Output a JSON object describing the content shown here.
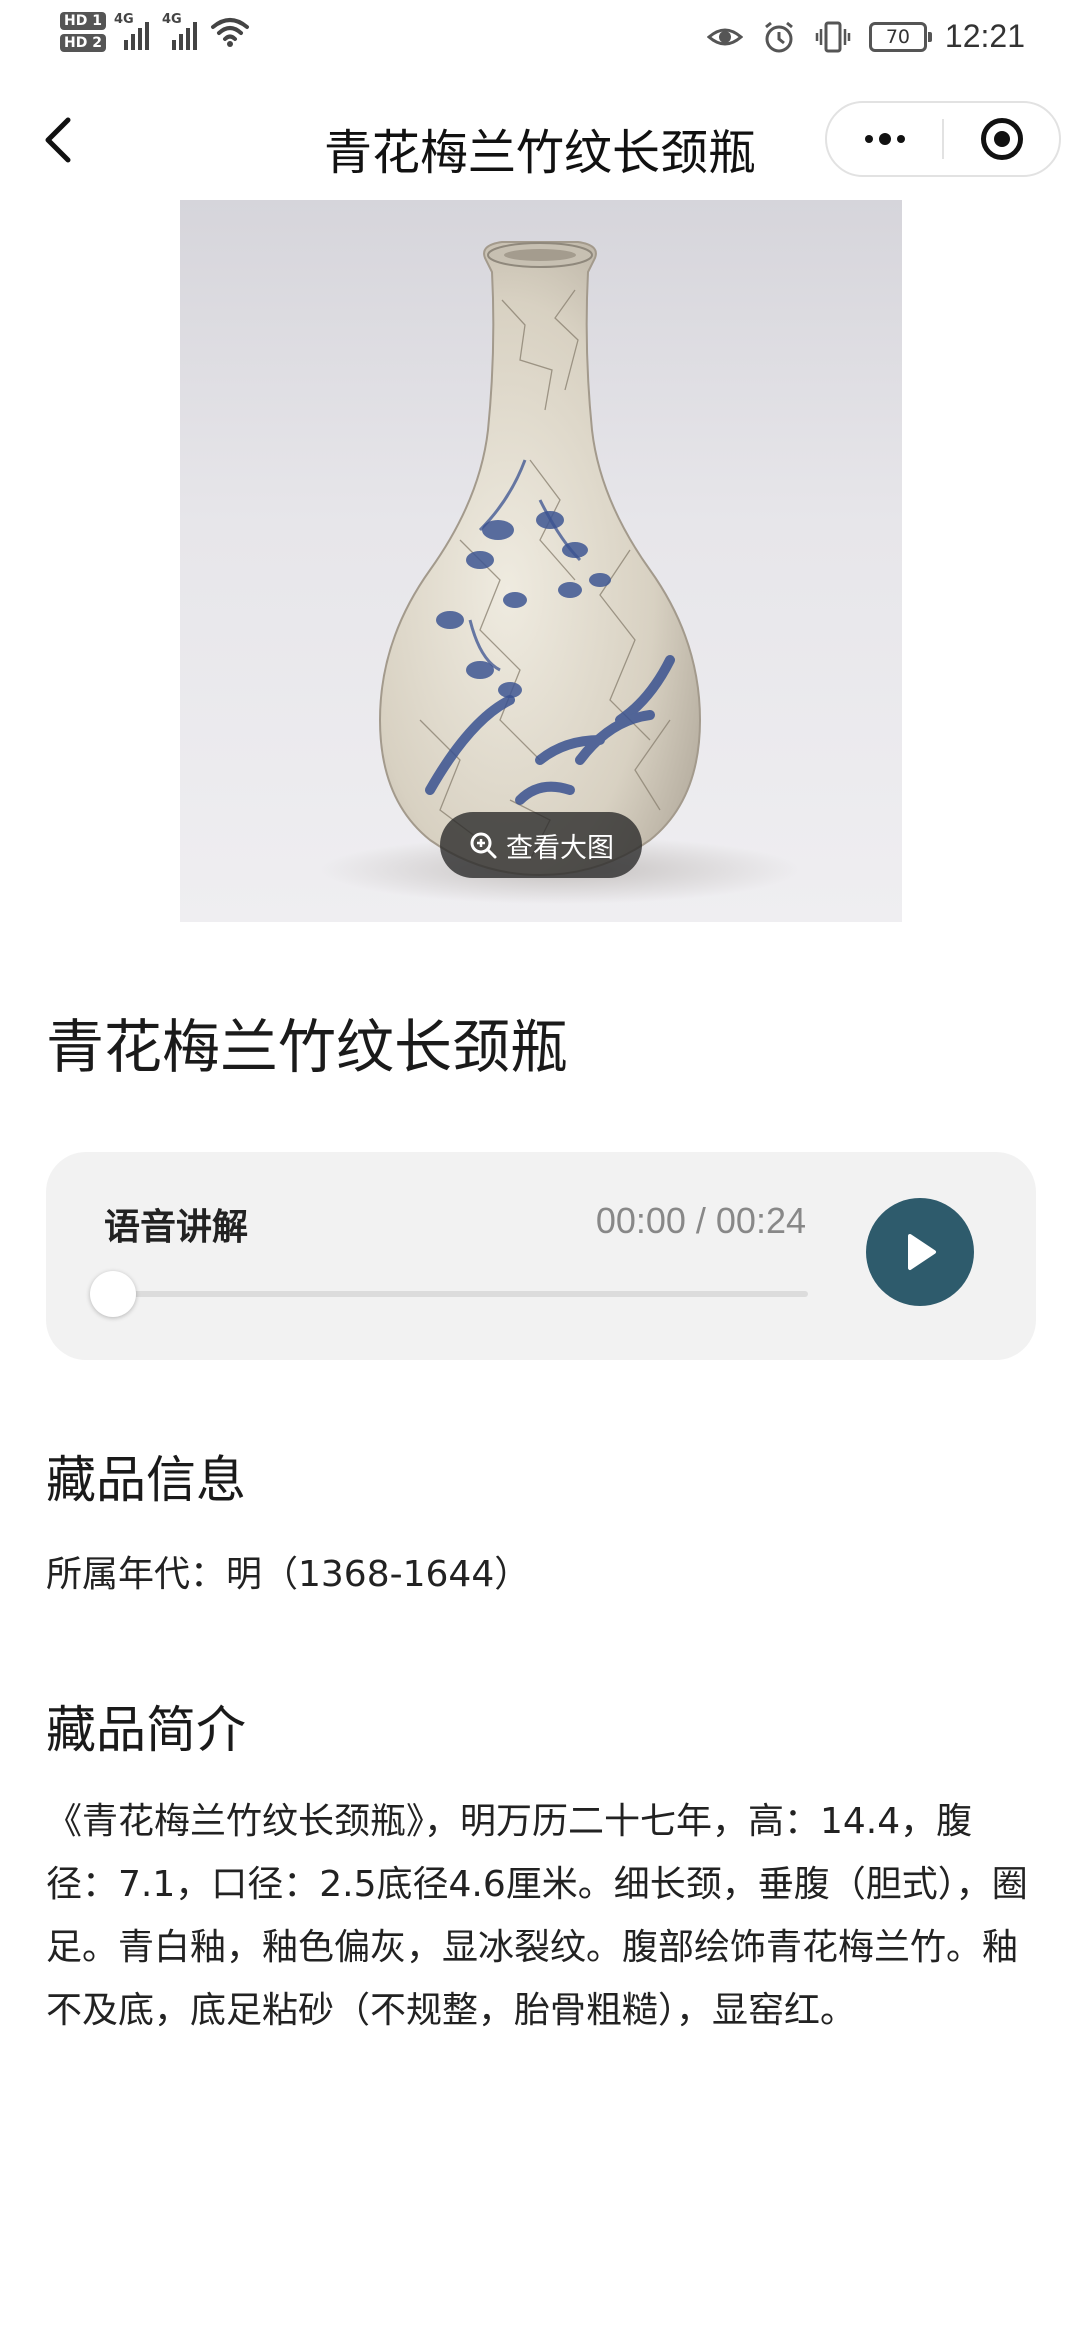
{
  "status_bar": {
    "sim1_label": "HD 1",
    "sim2_label": "HD 2",
    "signal1_label": "4G",
    "signal2_label": "4G",
    "battery": "70",
    "time": "12:21",
    "icons": [
      "eye-icon",
      "alarm-icon",
      "vibrate-icon",
      "wifi-icon"
    ]
  },
  "nav": {
    "title": "青花梅兰竹纹长颈瓶",
    "back_icon": "chevron-left-icon",
    "more_icon": "more-dots-icon",
    "close_icon": "target-circle-icon"
  },
  "photo": {
    "view_large_label": "查看大图",
    "zoom_icon": "zoom-in-icon"
  },
  "item_title": "青花梅兰竹纹长颈瓶",
  "audio": {
    "label": "语音讲解",
    "time": "00:00 / 00:24",
    "progress": 0,
    "play_icon": "play-icon",
    "accent": "#2e5b6c"
  },
  "info": {
    "heading": "藏品信息",
    "era": "所属年代：明（1368-1644）"
  },
  "intro": {
    "heading": "藏品简介",
    "text": "《青花梅兰竹纹长颈瓶》，明万历二十七年，高：14.4，腹径：7.1，口径：2.5底径4.6厘米。细长颈，垂腹（胆式），圈足。青白釉，釉色偏灰，显冰裂纹。腹部绘饰青花梅兰竹。釉不及底，底足粘砂（不规整，胎骨粗糙），显窑红。"
  }
}
